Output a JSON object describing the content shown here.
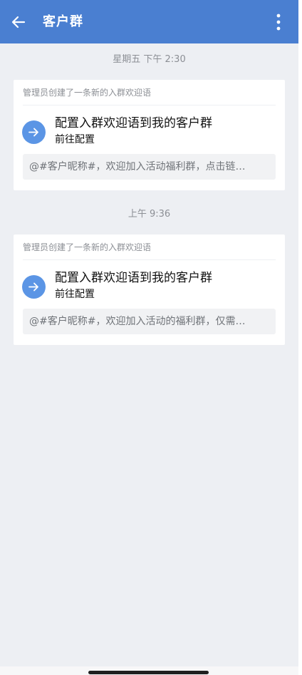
{
  "header": {
    "title": "客户群",
    "back_icon": "arrow-left-icon",
    "more_icon": "more-vertical-icon",
    "bar_color": "#4a7fd1"
  },
  "messages": [
    {
      "timestamp": "星期五  下午 2:30",
      "card_header": "管理员创建了一条新的入群欢迎语",
      "action_title": "配置入群欢迎语到我的客户群",
      "action_subtitle": "前往配置",
      "action_icon": "arrow-right-icon",
      "preview": "@#客户昵称#，欢迎加入活动福利群，点击链…"
    },
    {
      "timestamp": "上午 9:36",
      "card_header": "管理员创建了一条新的入群欢迎语",
      "action_title": "配置入群欢迎语到我的客户群",
      "action_subtitle": "前往配置",
      "action_icon": "arrow-right-icon",
      "preview": "@#客户昵称#，欢迎加入活动的福利群，仅需…"
    }
  ],
  "colors": {
    "accent": "#4a7fd1",
    "action_circle": "#5b95e5",
    "background": "#edeff3"
  }
}
